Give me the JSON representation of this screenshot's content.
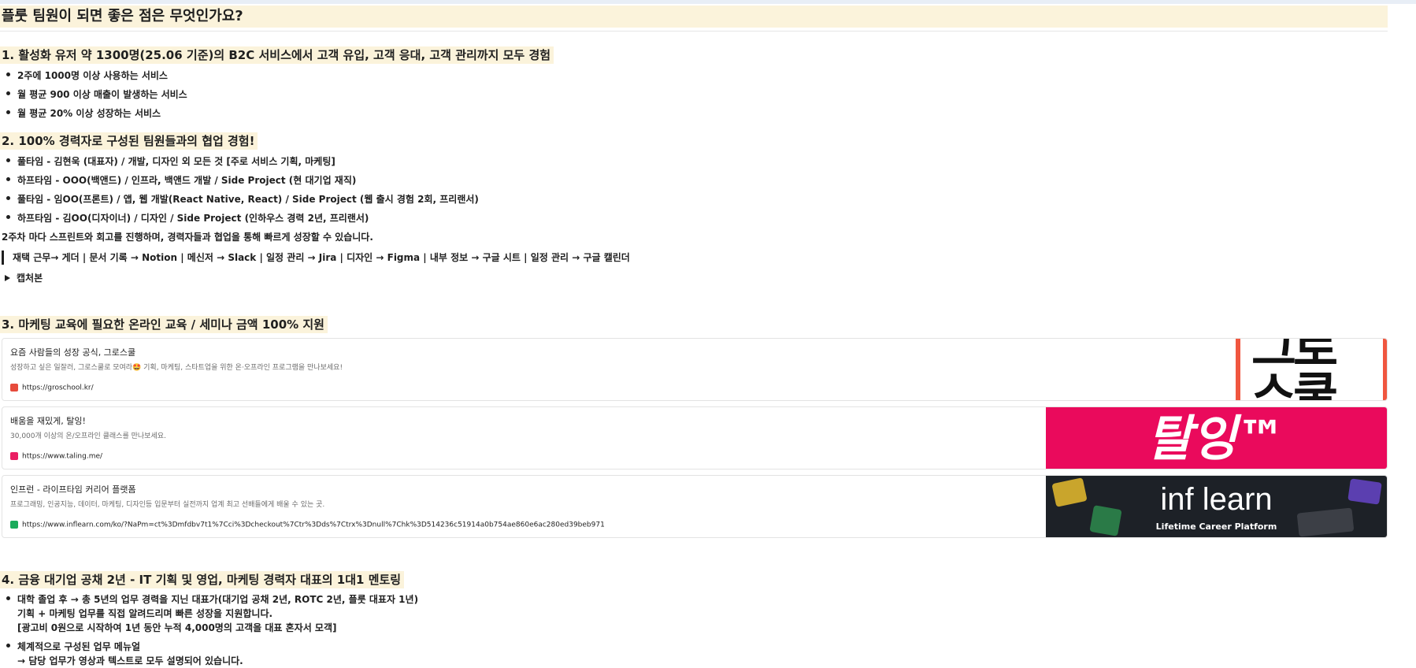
{
  "page_title": "플룻 팀원이 되면 좋은 점은 무엇인가요?",
  "sections": {
    "s1": {
      "heading": "1. 활성화 유저 약 1300명(25.06 기준)의 B2C 서비스에서 고객 유입, 고객 응대, 고객 관리까지 모두 경험",
      "items": [
        "2주에 1000명 이상 사용하는 서비스",
        "월 평균 900 이상 매출이 발생하는 서비스",
        "월 평균 20% 이상 성장하는 서비스"
      ]
    },
    "s2": {
      "heading": "2. 100% 경력자로 구성된 팀원들과의 협업 경험!",
      "items": [
        "풀타임 - 김현욱 (대표자) / 개발, 디자인 외 모든 것 [주로 서비스 기획, 마케팅]",
        "하프타임 - OOO(백앤드) / 인프라, 백앤드 개발 / Side Project (현 대기업 재직)",
        "풀타임 - 임OO(프론트) / 앱, 웹 개발(React Native, React)  / Side Project (웹 출시 경험 2회, 프리랜서)",
        "하프타임 - 김OO(디자이너) / 디자인  / Side Project (인하우스 경력 2년, 프리랜서)"
      ],
      "paragraph": "2주차 마다 스프린트와 회고를 진행하며, 경력자들과 협업을 통해 빠르게 성장할 수 있습니다.",
      "quote": "재택 근무→ 게더 | 문서 기록 → Notion | 메신저 → Slack | 일정 관리 → Jira | 디자인 → Figma | 내부 정보 → 구글 시트 | 일정 관리 → 구글 캘린더",
      "toggle": "캡처본"
    },
    "s3": {
      "heading": "3. 마케팅 교육에 필요한 온라인 교육 / 세미나 금액 100% 지원",
      "cards": [
        {
          "title": "요즘 사람들의 성장 공식, 그로스쿨",
          "desc": "성장하고 싶은 일잘러, 그로스쿨로 모여라🤩 기획, 마케팅, 스타트업을 위한 온·오프라인 프로그램을 만나보세요!",
          "url": "https://groschool.kr/",
          "thumb_text": "그로 스쿨",
          "fav_color": "#e64b3c",
          "thumb_bg": "#ffffff",
          "thumb_accent": "#f0563f"
        },
        {
          "title": "배움을 재밌게, 탈잉!",
          "desc": "30,000개 이상의 온/오프라인 클래스를 만나보세요.",
          "url": "https://www.taling.me/",
          "thumb_text": "탈잉™",
          "fav_color": "#ea1f63",
          "thumb_bg": "#ea0a5c"
        },
        {
          "title": "인프런 - 라이프타임 커리어 플랫폼",
          "desc": "프로그래밍, 인공지능, 데이터, 마케팅, 디자인등 입문부터 실전까지 업계 최고 선배들에게 배울 수 있는 곳.",
          "url": "https://www.inflearn.com/ko/?NaPm=ct%3Dmfdbv7t1%7Cci%3Dcheckout%7Ctr%3Dds%7Ctrx%3Dnull%7Chk%3D514236c51914a0b754ae860e6ac280ed39beb971",
          "thumb_text": "inf learn",
          "thumb_sub": "Lifetime Career Platform",
          "fav_color": "#1aab5b",
          "thumb_bg": "#1d2127"
        }
      ]
    },
    "s4": {
      "heading": "4. 금융 대기업 공채 2년 - IT 기획 및 영업, 마케팅 경력자 대표의 1대1 멘토링",
      "item1": [
        "대학 졸업 후 → 총 5년의 업무 경력을 지닌 대표가(대기업 공채 2년, ROTC 2년, 플룻 대표자 1년)",
        "기획 + 마케팅 업무를 직접 알려드리며 빠른 성장을 지원합니다.",
        "[광고비 0원으로 시작하여 1년 동안 누적 4,000명의 고객을 대표 혼자서 모객]"
      ],
      "item2": [
        "체계적으로 구성된 업무 메뉴얼",
        "→ 담당 업무가 영상과 텍스트로 모두 설명되어 있습니다."
      ]
    }
  }
}
